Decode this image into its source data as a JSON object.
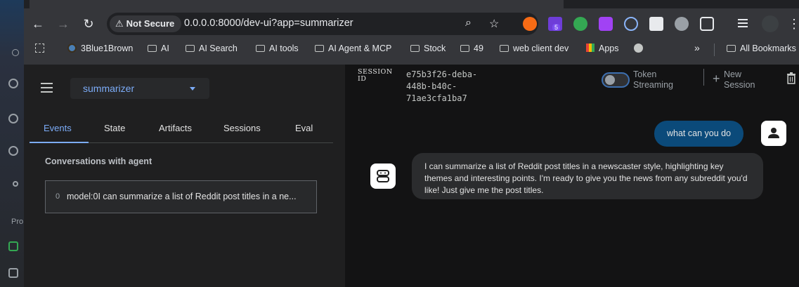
{
  "browser": {
    "security_label": "Not Secure",
    "url": "0.0.0.0:8000/dev-ui?app=summarizer",
    "extension_badge": "5",
    "bookmarks": [
      {
        "label": "3Blue1Brown",
        "icon": "3blue1brown-icon"
      },
      {
        "label": "AI",
        "icon": "folder-icon"
      },
      {
        "label": "AI Search",
        "icon": "folder-icon"
      },
      {
        "label": "AI tools",
        "icon": "folder-icon"
      },
      {
        "label": "AI Agent & MCP",
        "icon": "folder-icon"
      },
      {
        "label": "Stock",
        "icon": "folder-icon"
      },
      {
        "label": "49",
        "icon": "folder-icon"
      },
      {
        "label": "web client dev",
        "icon": "folder-icon"
      },
      {
        "label": "Apps",
        "icon": "apps-grid-icon"
      },
      {
        "label": "All Bookmarks",
        "icon": "folder-icon"
      }
    ],
    "overflow_label": "»"
  },
  "desktop": {
    "sidebar_text": "Pro"
  },
  "sidebar": {
    "app_name": "summarizer",
    "tabs": [
      {
        "label": "Events",
        "active": true
      },
      {
        "label": "State",
        "active": false
      },
      {
        "label": "Artifacts",
        "active": false
      },
      {
        "label": "Sessions",
        "active": false
      },
      {
        "label": "Eval",
        "active": false
      }
    ],
    "section_title": "Conversations with agent",
    "events": [
      {
        "index": "0",
        "text": "model:0I can summarize a list of Reddit post titles in a ne..."
      }
    ]
  },
  "header": {
    "session_label_line1": "SESSION",
    "session_label_line2": "ID",
    "session_id_line1": "e75b3f26-deba-448b-b40c-",
    "session_id_line2": "71ae3cfa1ba7",
    "token_streaming_line1": "Token",
    "token_streaming_line2": "Streaming",
    "token_streaming_on": false,
    "new_session_line1": "New",
    "new_session_line2": "Session"
  },
  "chat": {
    "user_message": "what can you do",
    "bot_message": "I can summarize a list of Reddit post titles in a newscaster style, highlighting key themes and interesting points. I'm ready to give you the news from any subreddit you'd like! Just give me the post titles."
  },
  "colors": {
    "accent": "#7cacf8",
    "user_bubble": "#0b4a7a",
    "bot_bubble": "#2b2c2e"
  }
}
